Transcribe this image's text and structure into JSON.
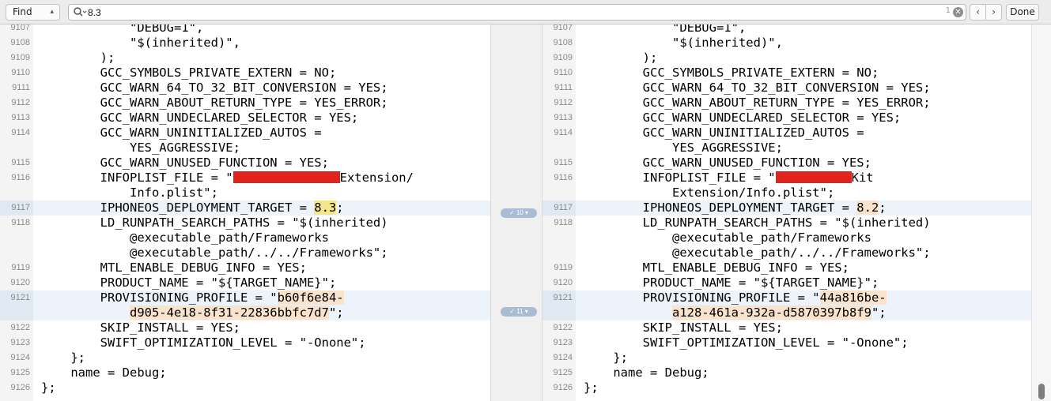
{
  "findbar": {
    "mode_label": "Find",
    "search_value": "8.3",
    "match_count": "1",
    "done_label": "Done"
  },
  "left_lines": [
    {
      "no": "9107",
      "text": "            \"DEBUG=1\","
    },
    {
      "no": "9108",
      "text": "            \"$(inherited)\","
    },
    {
      "no": "9109",
      "text": "        );"
    },
    {
      "no": "9110",
      "text": "        GCC_SYMBOLS_PRIVATE_EXTERN = NO;"
    },
    {
      "no": "9111",
      "text": "        GCC_WARN_64_TO_32_BIT_CONVERSION = YES;"
    },
    {
      "no": "9112",
      "text": "        GCC_WARN_ABOUT_RETURN_TYPE = YES_ERROR;"
    },
    {
      "no": "9113",
      "text": "        GCC_WARN_UNDECLARED_SELECTOR = YES;"
    },
    {
      "no": "9114",
      "text": "        GCC_WARN_UNINITIALIZED_AUTOS ="
    },
    {
      "no": "",
      "text": "            YES_AGGRESSIVE;"
    },
    {
      "no": "9115",
      "text": "        GCC_WARN_UNUSED_FUNCTION = YES;"
    },
    {
      "no": "9116",
      "text": "        INFOPLIST_FILE = \""
    },
    {
      "no": "",
      "text": "            Info.plist\";"
    },
    {
      "no": "9117",
      "text": "        IPHONEOS_DEPLOYMENT_TARGET = "
    },
    {
      "no": "9118",
      "text": "        LD_RUNPATH_SEARCH_PATHS = \"$(inherited)"
    },
    {
      "no": "",
      "text": "            @executable_path/Frameworks"
    },
    {
      "no": "",
      "text": "            @executable_path/../../Frameworks\";"
    },
    {
      "no": "9119",
      "text": "        MTL_ENABLE_DEBUG_INFO = YES;"
    },
    {
      "no": "9120",
      "text": "        PRODUCT_NAME = \"${TARGET_NAME}\";"
    },
    {
      "no": "9121",
      "text": "        PROVISIONING_PROFILE = \""
    },
    {
      "no": "",
      "text": "            "
    },
    {
      "no": "9122",
      "text": "        SKIP_INSTALL = YES;"
    },
    {
      "no": "9123",
      "text": "        SWIFT_OPTIMIZATION_LEVEL = \"-Onone\";"
    },
    {
      "no": "9124",
      "text": "    };"
    },
    {
      "no": "9125",
      "text": "    name = Debug;"
    },
    {
      "no": "9126",
      "text": "};"
    }
  ],
  "right_lines": [
    {
      "no": "9107",
      "text": "            \"DEBUG=1\","
    },
    {
      "no": "9108",
      "text": "            \"$(inherited)\","
    },
    {
      "no": "9109",
      "text": "        );"
    },
    {
      "no": "9110",
      "text": "        GCC_SYMBOLS_PRIVATE_EXTERN = NO;"
    },
    {
      "no": "9111",
      "text": "        GCC_WARN_64_TO_32_BIT_CONVERSION = YES;"
    },
    {
      "no": "9112",
      "text": "        GCC_WARN_ABOUT_RETURN_TYPE = YES_ERROR;"
    },
    {
      "no": "9113",
      "text": "        GCC_WARN_UNDECLARED_SELECTOR = YES;"
    },
    {
      "no": "9114",
      "text": "        GCC_WARN_UNINITIALIZED_AUTOS ="
    },
    {
      "no": "",
      "text": "            YES_AGGRESSIVE;"
    },
    {
      "no": "9115",
      "text": "        GCC_WARN_UNUSED_FUNCTION = YES;"
    },
    {
      "no": "9116",
      "text": "        INFOPLIST_FILE = \""
    },
    {
      "no": "",
      "text": "            Extension/Info.plist\";"
    },
    {
      "no": "9117",
      "text": "        IPHONEOS_DEPLOYMENT_TARGET = "
    },
    {
      "no": "9118",
      "text": "        LD_RUNPATH_SEARCH_PATHS = \"$(inherited)"
    },
    {
      "no": "",
      "text": "            @executable_path/Frameworks"
    },
    {
      "no": "",
      "text": "            @executable_path/../../Frameworks\";"
    },
    {
      "no": "9119",
      "text": "        MTL_ENABLE_DEBUG_INFO = YES;"
    },
    {
      "no": "9120",
      "text": "        PRODUCT_NAME = \"${TARGET_NAME}\";"
    },
    {
      "no": "9121",
      "text": "        PROVISIONING_PROFILE = \""
    },
    {
      "no": "",
      "text": "            "
    },
    {
      "no": "9122",
      "text": "        SKIP_INSTALL = YES;"
    },
    {
      "no": "9123",
      "text": "        SWIFT_OPTIMIZATION_LEVEL = \"-Onone\";"
    },
    {
      "no": "9124",
      "text": "    };"
    },
    {
      "no": "9125",
      "text": "    name = Debug;"
    },
    {
      "no": "9126",
      "text": "};"
    }
  ],
  "left_extras": {
    "infoplist_suffix": "Extension/",
    "deploy_value": "8.3",
    "deploy_end": ";",
    "profile_part1": "b60f6e84-",
    "profile_part2": "d905-4e18-8f31-22836bbfc7d7",
    "profile_end": "\";"
  },
  "right_extras": {
    "infoplist_suffix": "Kit",
    "deploy_value": "8.2",
    "deploy_end": ";",
    "profile_part1": "44a816be-",
    "profile_part2": "a128-461a-932a-d5870397b8f9",
    "profile_end": "\";"
  },
  "diff_markers": [
    {
      "label": "10"
    },
    {
      "label": "11"
    }
  ],
  "colors": {
    "find_highlight": "#f5e68a",
    "diff_highlight": "#f9e3cd",
    "changed_row": "#edf3fb",
    "redaction": "#e0231b"
  }
}
